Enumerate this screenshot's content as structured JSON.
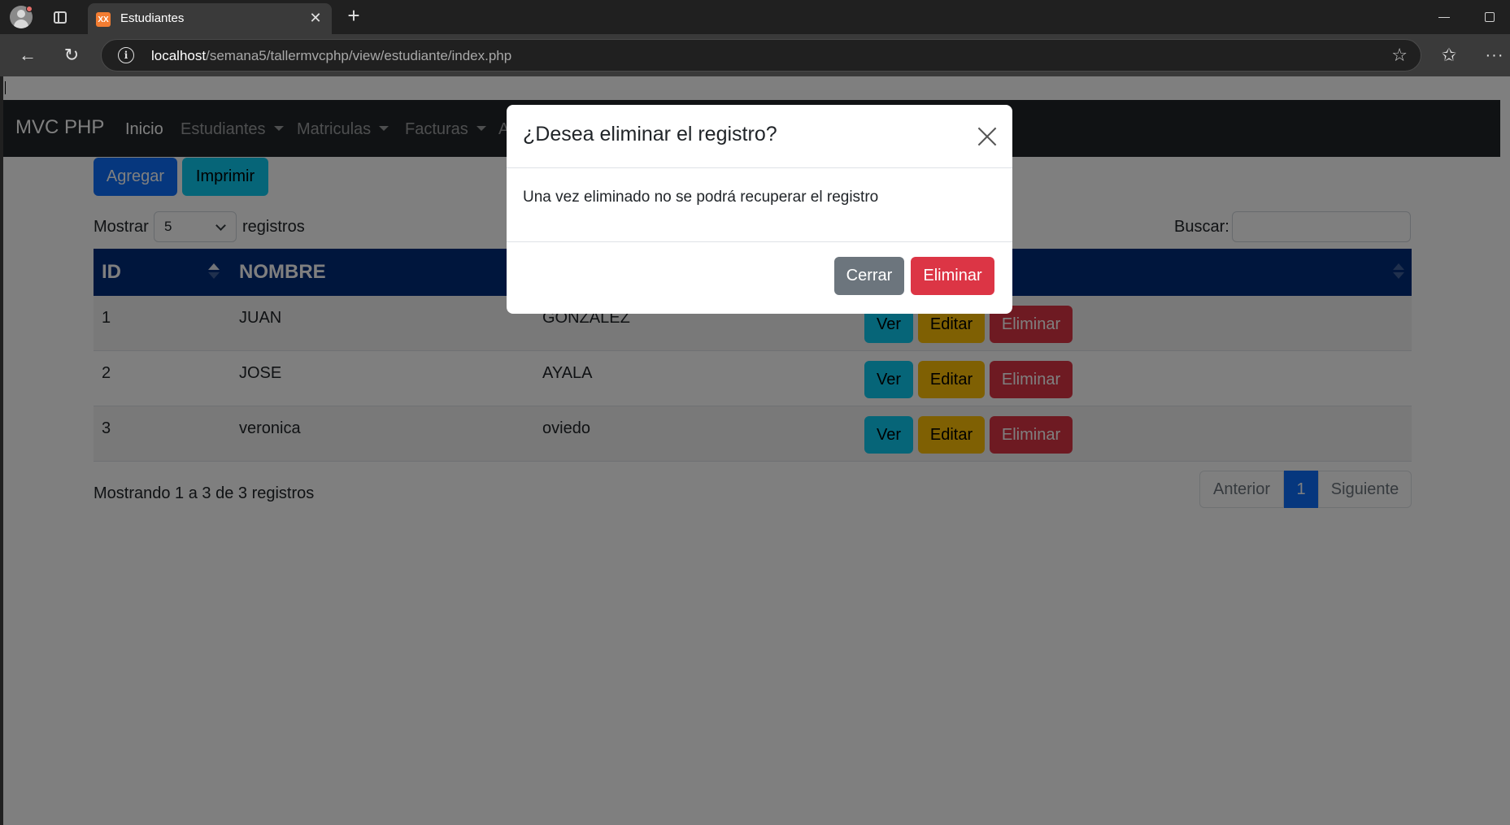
{
  "browser": {
    "tab_title": "Estudiantes",
    "tab_favicon_text": "XX",
    "url_host": "localhost",
    "url_path": "/semana5/tallermvcphp/view/estudiante/index.php"
  },
  "app": {
    "brand": "MVC PHP",
    "nav": [
      "Inicio",
      "Estudiantes",
      "Matriculas",
      "Facturas",
      "A"
    ]
  },
  "toolbar": {
    "add_label": "Agregar",
    "print_label": "Imprimir"
  },
  "length_menu": {
    "prefix": "Mostrar",
    "value": "5",
    "suffix": "registros"
  },
  "search": {
    "label": "Buscar:",
    "placeholder": ""
  },
  "table": {
    "headers": [
      "ID",
      "NOMBRE",
      "",
      ""
    ],
    "rows": [
      {
        "id": "1",
        "nombre": "JUAN",
        "apellido": "GONZALEZ"
      },
      {
        "id": "2",
        "nombre": "JOSE",
        "apellido": "AYALA"
      },
      {
        "id": "3",
        "nombre": "veronica",
        "apellido": "oviedo"
      }
    ],
    "action_labels": {
      "view": "Ver",
      "edit": "Editar",
      "delete": "Eliminar"
    }
  },
  "table_info": "Mostrando 1 a 3 de 3 registros",
  "pagination": {
    "prev": "Anterior",
    "page": "1",
    "next": "Siguiente"
  },
  "modal": {
    "title": "¿Desea eliminar el registro?",
    "body": "Una vez eliminado no se podrá recuperar el registro",
    "close_label": "Cerrar",
    "confirm_label": "Eliminar"
  },
  "colors": {
    "primary": "#0d6efd",
    "info": "#0dcaf0",
    "warning": "#ffc107",
    "danger": "#dc3545",
    "secondary": "#6c757d",
    "table_header": "#002c7a",
    "navbar": "#212529"
  }
}
